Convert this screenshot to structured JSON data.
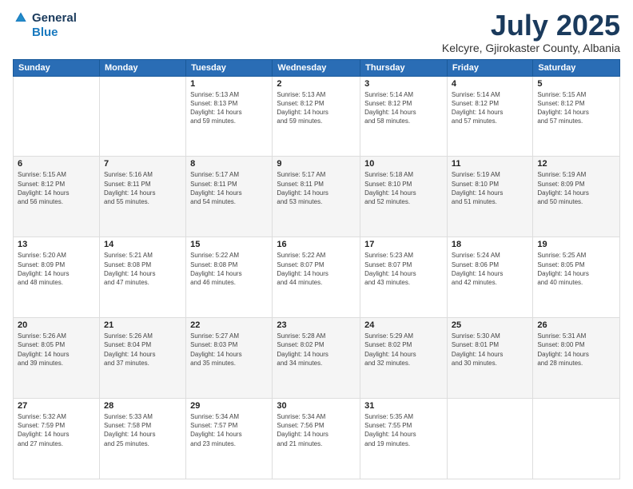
{
  "logo": {
    "general": "General",
    "blue": "Blue"
  },
  "title": "July 2025",
  "location": "Kelcyre, Gjirokaster County, Albania",
  "headers": [
    "Sunday",
    "Monday",
    "Tuesday",
    "Wednesday",
    "Thursday",
    "Friday",
    "Saturday"
  ],
  "weeks": [
    [
      {
        "day": "",
        "info": ""
      },
      {
        "day": "",
        "info": ""
      },
      {
        "day": "1",
        "sunrise": "5:13 AM",
        "sunset": "8:13 PM",
        "daylight": "14 hours and 59 minutes."
      },
      {
        "day": "2",
        "sunrise": "5:13 AM",
        "sunset": "8:12 PM",
        "daylight": "14 hours and 59 minutes."
      },
      {
        "day": "3",
        "sunrise": "5:14 AM",
        "sunset": "8:12 PM",
        "daylight": "14 hours and 58 minutes."
      },
      {
        "day": "4",
        "sunrise": "5:14 AM",
        "sunset": "8:12 PM",
        "daylight": "14 hours and 57 minutes."
      },
      {
        "day": "5",
        "sunrise": "5:15 AM",
        "sunset": "8:12 PM",
        "daylight": "14 hours and 57 minutes."
      }
    ],
    [
      {
        "day": "6",
        "sunrise": "5:15 AM",
        "sunset": "8:12 PM",
        "daylight": "14 hours and 56 minutes."
      },
      {
        "day": "7",
        "sunrise": "5:16 AM",
        "sunset": "8:11 PM",
        "daylight": "14 hours and 55 minutes."
      },
      {
        "day": "8",
        "sunrise": "5:17 AM",
        "sunset": "8:11 PM",
        "daylight": "14 hours and 54 minutes."
      },
      {
        "day": "9",
        "sunrise": "5:17 AM",
        "sunset": "8:11 PM",
        "daylight": "14 hours and 53 minutes."
      },
      {
        "day": "10",
        "sunrise": "5:18 AM",
        "sunset": "8:10 PM",
        "daylight": "14 hours and 52 minutes."
      },
      {
        "day": "11",
        "sunrise": "5:19 AM",
        "sunset": "8:10 PM",
        "daylight": "14 hours and 51 minutes."
      },
      {
        "day": "12",
        "sunrise": "5:19 AM",
        "sunset": "8:09 PM",
        "daylight": "14 hours and 50 minutes."
      }
    ],
    [
      {
        "day": "13",
        "sunrise": "5:20 AM",
        "sunset": "8:09 PM",
        "daylight": "14 hours and 48 minutes."
      },
      {
        "day": "14",
        "sunrise": "5:21 AM",
        "sunset": "8:08 PM",
        "daylight": "14 hours and 47 minutes."
      },
      {
        "day": "15",
        "sunrise": "5:22 AM",
        "sunset": "8:08 PM",
        "daylight": "14 hours and 46 minutes."
      },
      {
        "day": "16",
        "sunrise": "5:22 AM",
        "sunset": "8:07 PM",
        "daylight": "14 hours and 44 minutes."
      },
      {
        "day": "17",
        "sunrise": "5:23 AM",
        "sunset": "8:07 PM",
        "daylight": "14 hours and 43 minutes."
      },
      {
        "day": "18",
        "sunrise": "5:24 AM",
        "sunset": "8:06 PM",
        "daylight": "14 hours and 42 minutes."
      },
      {
        "day": "19",
        "sunrise": "5:25 AM",
        "sunset": "8:05 PM",
        "daylight": "14 hours and 40 minutes."
      }
    ],
    [
      {
        "day": "20",
        "sunrise": "5:26 AM",
        "sunset": "8:05 PM",
        "daylight": "14 hours and 39 minutes."
      },
      {
        "day": "21",
        "sunrise": "5:26 AM",
        "sunset": "8:04 PM",
        "daylight": "14 hours and 37 minutes."
      },
      {
        "day": "22",
        "sunrise": "5:27 AM",
        "sunset": "8:03 PM",
        "daylight": "14 hours and 35 minutes."
      },
      {
        "day": "23",
        "sunrise": "5:28 AM",
        "sunset": "8:02 PM",
        "daylight": "14 hours and 34 minutes."
      },
      {
        "day": "24",
        "sunrise": "5:29 AM",
        "sunset": "8:02 PM",
        "daylight": "14 hours and 32 minutes."
      },
      {
        "day": "25",
        "sunrise": "5:30 AM",
        "sunset": "8:01 PM",
        "daylight": "14 hours and 30 minutes."
      },
      {
        "day": "26",
        "sunrise": "5:31 AM",
        "sunset": "8:00 PM",
        "daylight": "14 hours and 28 minutes."
      }
    ],
    [
      {
        "day": "27",
        "sunrise": "5:32 AM",
        "sunset": "7:59 PM",
        "daylight": "14 hours and 27 minutes."
      },
      {
        "day": "28",
        "sunrise": "5:33 AM",
        "sunset": "7:58 PM",
        "daylight": "14 hours and 25 minutes."
      },
      {
        "day": "29",
        "sunrise": "5:34 AM",
        "sunset": "7:57 PM",
        "daylight": "14 hours and 23 minutes."
      },
      {
        "day": "30",
        "sunrise": "5:34 AM",
        "sunset": "7:56 PM",
        "daylight": "14 hours and 21 minutes."
      },
      {
        "day": "31",
        "sunrise": "5:35 AM",
        "sunset": "7:55 PM",
        "daylight": "14 hours and 19 minutes."
      },
      {
        "day": "",
        "info": ""
      },
      {
        "day": "",
        "info": ""
      }
    ]
  ],
  "labels": {
    "sunrise": "Sunrise:",
    "sunset": "Sunset:",
    "daylight": "Daylight:"
  }
}
